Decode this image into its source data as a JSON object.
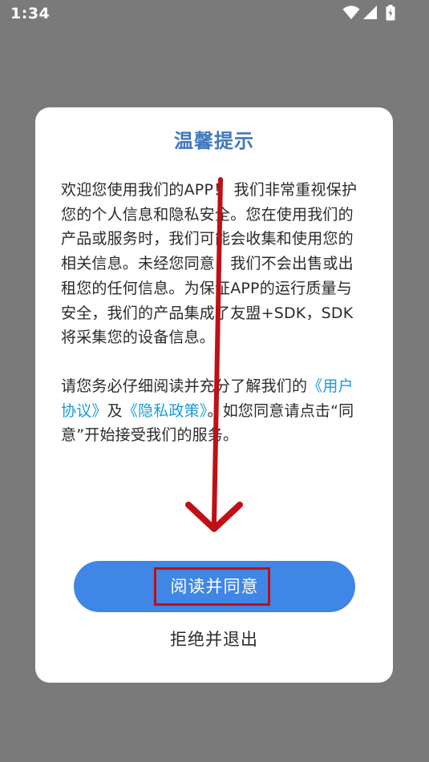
{
  "status_bar": {
    "time": "1:34",
    "icons": [
      "wifi-icon",
      "signal-icon",
      "battery-icon"
    ]
  },
  "dialog": {
    "title": "温馨提示",
    "paragraph1": {
      "text": "欢迎您使用我们的APP！ 我们非常重视保护您的个人信息和隐私安全。您在使用我们的产品或服务时，我们可能会收集和使用您的相关信息。未经您同意，我们不会出售或出租您的任何信息。为保证APP的运行质量与安全，我们的产品集成了友盟+SDK，SDK将采集您的设备信息。"
    },
    "paragraph2": {
      "prefix": "请您务必仔细阅读并充分了解我们的",
      "link_user_agreement": "《用户协议》",
      "conjunction": "及",
      "link_privacy_policy": "《隐私政策》",
      "suffix": "。如您同意请点击“同意”开始接受我们的服务。"
    },
    "agree_label": "阅读并同意",
    "reject_label": "拒绝并退出"
  },
  "colors": {
    "overlay": "#7a7a7a",
    "title": "#4178bd",
    "link": "#1a9bd8",
    "primary_button": "#3f86e6",
    "annotation_red": "#c00f16"
  }
}
